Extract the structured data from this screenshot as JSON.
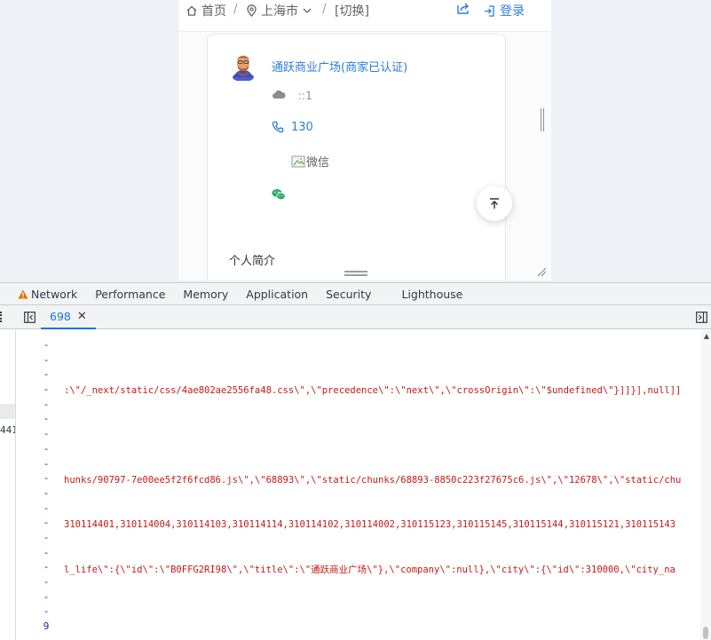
{
  "preview": {
    "navbar": {
      "home": "首页",
      "sep": "/",
      "city": "上海市",
      "switch": "[切换]",
      "login": "登录"
    },
    "card": {
      "shop_name": "通跃商业广场(商家已认证)",
      "cloud_text": "::1",
      "phone": "130",
      "wechat_alt": "微信",
      "intro_title": "个人简介"
    },
    "colors": {
      "link": "#2d7ddb",
      "wechat": "#2aae67"
    }
  },
  "devtools": {
    "tabs": [
      "Network",
      "Performance",
      "Memory",
      "Application",
      "Security",
      "Lighthouse"
    ],
    "open_file": "698",
    "nav_number": "441",
    "gutter": [
      "-",
      "-",
      "-",
      "-",
      "-",
      "-",
      "-",
      "-",
      "-",
      "-",
      "-",
      "-",
      "-",
      "-",
      "-",
      "-",
      "-",
      "-",
      "-",
      "9"
    ],
    "code_lines": [
      ":\\\"/_next/static/css/4ae802ae2556fa48.css\\\",\\\"precedence\\\":\\\"next\\\",\\\"crossOrigin\\\":\\\"$undefined\\\"}]]}],null]]",
      "hunks/90797-7e00ee5f2f6fcd86.js\\\",\\\"68893\\\",\\\"static/chunks/68893-8850c223f27675c6.js\\\",\\\"12678\\\",\\\"static/chu",
      "310114401,310114004,310114103,310114114,310114102,310114002,310115123,310115145,310115144,310115121,310115143",
      "l_life\\\":{\\\"id\\\":\\\"B0FFG2RI98\\\",\\\"title\\\":\\\"通跃商业广场\\\"},\\\"company\\\":null},\\\"city\\\":{\\\"id\\\":310000,\\\"city_na"
    ]
  }
}
